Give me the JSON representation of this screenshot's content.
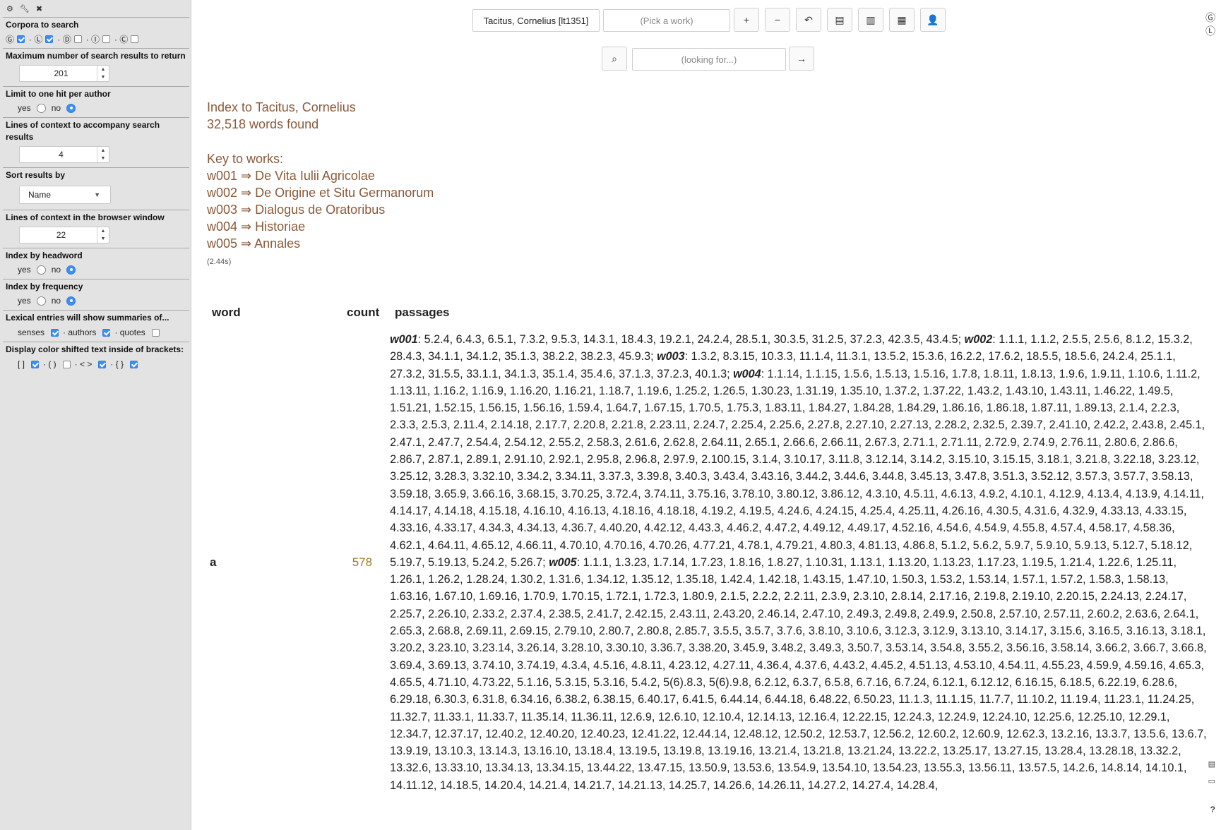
{
  "sidebar": {
    "top_icons": [
      "gear-icon",
      "wrench-icon",
      "close-icon"
    ],
    "top_glyphs": [
      "⚙",
      "🔧",
      "✖"
    ],
    "corpora": {
      "title": "Corpora to search",
      "items": [
        {
          "glyph": "Ⓖ",
          "checked": true
        },
        {
          "glyph": "Ⓛ",
          "checked": true
        },
        {
          "glyph": "Ⓓ",
          "checked": false
        },
        {
          "glyph": "Ⓘ",
          "checked": false
        },
        {
          "glyph": "Ⓒ",
          "checked": false
        }
      ]
    },
    "max_results": {
      "title": "Maximum number of search results to return",
      "value": "201"
    },
    "limit_one_hit": {
      "title": "Limit to one hit per author",
      "yes": "yes",
      "no": "no",
      "selected": "no"
    },
    "context_lines": {
      "title": "Lines of context to accompany search results",
      "value": "4"
    },
    "sort_by": {
      "title": "Sort results by",
      "value": "Name"
    },
    "browser_context": {
      "title": "Lines of context in the browser window",
      "value": "22"
    },
    "index_headword": {
      "title": "Index by headword",
      "yes": "yes",
      "no": "no",
      "selected": "no"
    },
    "index_frequency": {
      "title": "Index by frequency",
      "yes": "yes",
      "no": "no",
      "selected": "no"
    },
    "lexical": {
      "title": "Lexical entries will show summaries of...",
      "senses": "senses",
      "senses_checked": true,
      "authors": "· authors",
      "authors_checked": true,
      "quotes": "· quotes",
      "quotes_checked": false
    },
    "brackets": {
      "title": "Display color shifted text inside of brackets:",
      "items": [
        {
          "label": "[ ]",
          "checked": true
        },
        {
          "label": "· ( )",
          "checked": false
        },
        {
          "label": "· < >",
          "checked": true
        },
        {
          "label": "· { }",
          "checked": true
        }
      ]
    }
  },
  "toolbar": {
    "author": "Tacitus, Cornelius [lt1351]",
    "work_placeholder": "(Pick a work)",
    "search_placeholder": "(looking for...)",
    "buttons": [
      "+",
      "−",
      "↶",
      "▤",
      "▥",
      "▦",
      "👤"
    ],
    "go": "→",
    "search_icon": "⌕"
  },
  "index": {
    "heading": "Index to Tacitus, Cornelius",
    "words_found": "32,518 words found",
    "key_title": "Key to works:",
    "works": [
      "w001 ⇒ De Vita Iulii Agricolae",
      "w002 ⇒ De Origine et Situ Germanorum",
      "w003 ⇒ Dialogus de Oratoribus",
      "w004 ⇒ Historiae",
      "w005 ⇒ Annales"
    ],
    "timing": "(2.44s)"
  },
  "table": {
    "headers": {
      "word": "word",
      "count": "count",
      "passages": "passages"
    },
    "rows": [
      {
        "word": "a",
        "count": "578",
        "passages": [
          {
            "work": "w001",
            "refs": "5.2.4, 6.4.3, 6.5.1, 7.3.2, 9.5.3, 14.3.1, 18.4.3, 19.2.1, 24.2.4, 28.5.1, 30.3.5, 31.2.5, 37.2.3, 42.3.5, 43.4.5"
          },
          {
            "work": "w002",
            "refs": "1.1.1, 1.1.2, 2.5.5, 2.5.6, 8.1.2, 15.3.2, 28.4.3, 34.1.1, 34.1.2, 35.1.3, 38.2.2, 38.2.3, 45.9.3"
          },
          {
            "work": "w003",
            "refs": "1.3.2, 8.3.15, 10.3.3, 11.1.4, 11.3.1, 13.5.2, 15.3.6, 16.2.2, 17.6.2, 18.5.5, 18.5.6, 24.2.4, 25.1.1, 27.3.2, 31.5.5, 33.1.1, 34.1.3, 35.1.4, 35.4.6, 37.1.3, 37.2.3, 40.1.3"
          },
          {
            "work": "w004",
            "refs": "1.1.14, 1.1.15, 1.5.6, 1.5.13, 1.5.16, 1.7.8, 1.8.11, 1.8.13, 1.9.6, 1.9.11, 1.10.6, 1.11.2, 1.13.11, 1.16.2, 1.16.9, 1.16.20, 1.16.21, 1.18.7, 1.19.6, 1.25.2, 1.26.5, 1.30.23, 1.31.19, 1.35.10, 1.37.2, 1.37.22, 1.43.2, 1.43.10, 1.43.11, 1.46.22, 1.49.5, 1.51.21, 1.52.15, 1.56.15, 1.56.16, 1.59.4, 1.64.7, 1.67.15, 1.70.5, 1.75.3, 1.83.11, 1.84.27, 1.84.28, 1.84.29, 1.86.16, 1.86.18, 1.87.11, 1.89.13, 2.1.4, 2.2.3, 2.3.3, 2.5.3, 2.11.4, 2.14.18, 2.17.7, 2.20.8, 2.21.8, 2.23.11, 2.24.7, 2.25.4, 2.25.6, 2.27.8, 2.27.10, 2.27.13, 2.28.2, 2.32.5, 2.39.7, 2.41.10, 2.42.2, 2.43.8, 2.45.1, 2.47.1, 2.47.7, 2.54.4, 2.54.12, 2.55.2, 2.58.3, 2.61.6, 2.62.8, 2.64.11, 2.65.1, 2.66.6, 2.66.11, 2.67.3, 2.71.1, 2.71.11, 2.72.9, 2.74.9, 2.76.11, 2.80.6, 2.86.6, 2.86.7, 2.87.1, 2.89.1, 2.91.10, 2.92.1, 2.95.8, 2.96.8, 2.97.9, 2.100.15, 3.1.4, 3.10.17, 3.11.8, 3.12.14, 3.14.2, 3.15.10, 3.15.15, 3.18.1, 3.21.8, 3.22.18, 3.23.12, 3.25.12, 3.28.3, 3.32.10, 3.34.2, 3.34.11, 3.37.3, 3.39.8, 3.40.3, 3.43.4, 3.43.16, 3.44.2, 3.44.6, 3.44.8, 3.45.13, 3.47.8, 3.51.3, 3.52.12, 3.57.3, 3.57.7, 3.58.13, 3.59.18, 3.65.9, 3.66.16, 3.68.15, 3.70.25, 3.72.4, 3.74.11, 3.75.16, 3.78.10, 3.80.12, 3.86.12, 4.3.10, 4.5.11, 4.6.13, 4.9.2, 4.10.1, 4.12.9, 4.13.4, 4.13.9, 4.14.11, 4.14.17, 4.14.18, 4.15.18, 4.16.10, 4.16.13, 4.18.16, 4.18.18, 4.19.2, 4.19.5, 4.24.6, 4.24.15, 4.25.4, 4.25.11, 4.26.16, 4.30.5, 4.31.6, 4.32.9, 4.33.13, 4.33.15, 4.33.16, 4.33.17, 4.34.3, 4.34.13, 4.36.7, 4.40.20, 4.42.12, 4.43.3, 4.46.2, 4.47.2, 4.49.12, 4.49.17, 4.52.16, 4.54.6, 4.54.9, 4.55.8, 4.57.4, 4.58.17, 4.58.36, 4.62.1, 4.64.11, 4.65.12, 4.66.11, 4.70.10, 4.70.16, 4.70.26, 4.77.21, 4.78.1, 4.79.21, 4.80.3, 4.81.13, 4.86.8, 5.1.2, 5.6.2, 5.9.7, 5.9.10, 5.9.13, 5.12.7, 5.18.12, 5.19.7, 5.19.13, 5.24.2, 5.26.7"
          },
          {
            "work": "w005",
            "refs": "1.1.1, 1.3.23, 1.7.14, 1.7.23, 1.8.16, 1.8.27, 1.10.31, 1.13.1, 1.13.20, 1.13.23, 1.17.23, 1.19.5, 1.21.4, 1.22.6, 1.25.11, 1.26.1, 1.26.2, 1.28.24, 1.30.2, 1.31.6, 1.34.12, 1.35.12, 1.35.18, 1.42.4, 1.42.18, 1.43.15, 1.47.10, 1.50.3, 1.53.2, 1.53.14, 1.57.1, 1.57.2, 1.58.3, 1.58.13, 1.63.16, 1.67.10, 1.69.16, 1.70.9, 1.70.15, 1.72.1, 1.72.3, 1.80.9, 2.1.5, 2.2.2, 2.2.11, 2.3.9, 2.3.10, 2.8.14, 2.17.16, 2.19.8, 2.19.10, 2.20.15, 2.24.13, 2.24.17, 2.25.7, 2.26.10, 2.33.2, 2.37.4, 2.38.5, 2.41.7, 2.42.15, 2.43.11, 2.43.20, 2.46.14, 2.47.10, 2.49.3, 2.49.8, 2.49.9, 2.50.8, 2.57.10, 2.57.11, 2.60.2, 2.63.6, 2.64.1, 2.65.3, 2.68.8, 2.69.11, 2.69.15, 2.79.10, 2.80.7, 2.80.8, 2.85.7, 3.5.5, 3.5.7, 3.7.6, 3.8.10, 3.10.6, 3.12.3, 3.12.9, 3.13.10, 3.14.17, 3.15.6, 3.16.5, 3.16.13, 3.18.1, 3.20.2, 3.23.10, 3.23.14, 3.26.14, 3.28.10, 3.30.10, 3.36.7, 3.38.20, 3.45.9, 3.48.2, 3.49.3, 3.50.7, 3.53.14, 3.54.8, 3.55.2, 3.56.16, 3.58.14, 3.66.2, 3.66.7, 3.66.8, 3.69.4, 3.69.13, 3.74.10, 3.74.19, 4.3.4, 4.5.16, 4.8.11, 4.23.12, 4.27.11, 4.36.4, 4.37.6, 4.43.2, 4.45.2, 4.51.13, 4.53.10, 4.54.11, 4.55.23, 4.59.9, 4.59.16, 4.65.3, 4.65.5, 4.71.10, 4.73.22, 5.1.16, 5.3.15, 5.3.16, 5.4.2, 5(6).8.3, 5(6).9.8, 6.2.12, 6.3.7, 6.5.8, 6.7.16, 6.7.24, 6.12.1, 6.12.12, 6.16.15, 6.18.5, 6.22.19, 6.28.6, 6.29.18, 6.30.3, 6.31.8, 6.34.16, 6.38.2, 6.38.15, 6.40.17, 6.41.5, 6.44.14, 6.44.18, 6.48.22, 6.50.23, 11.1.3, 11.1.15, 11.7.7, 11.10.2, 11.19.4, 11.23.1, 11.24.25, 11.32.7, 11.33.1, 11.33.7, 11.35.14, 11.36.11, 12.6.9, 12.6.10, 12.10.4, 12.14.13, 12.16.4, 12.22.15, 12.24.3, 12.24.9, 12.24.10, 12.25.6, 12.25.10, 12.29.1, 12.34.7, 12.37.17, 12.40.2, 12.40.20, 12.40.23, 12.41.22, 12.44.14, 12.48.12, 12.50.2, 12.53.7, 12.56.2, 12.60.2, 12.60.9, 12.62.3, 13.2.16, 13.3.7, 13.5.6, 13.6.7, 13.9.19, 13.10.3, 13.14.3, 13.16.10, 13.18.4, 13.19.5, 13.19.8, 13.19.16, 13.21.4, 13.21.8, 13.21.24, 13.22.2, 13.25.17, 13.27.15, 13.28.4, 13.28.18, 13.32.2, 13.32.6, 13.33.10, 13.34.13, 13.34.15, 13.44.22, 13.47.15, 13.50.9, 13.53.6, 13.54.9, 13.54.10, 13.54.23, 13.55.3, 13.56.11, 13.57.5, 14.2.6, 14.8.14, 14.10.1, 14.11.12, 14.18.5, 14.20.4, 14.21.4, 14.21.7, 14.21.13, 14.25.7, 14.26.6, 14.26.11, 14.27.2, 14.27.4, 14.28.4,"
          }
        ]
      }
    ]
  },
  "right_edge": {
    "top_glyphs": [
      "Ⓖ",
      "Ⓛ"
    ],
    "bottom_glyphs": [
      "🗄",
      "📂",
      "?"
    ]
  },
  "colors": {
    "accent": "#3b8ff6",
    "heading_brown": "#8a5a3a",
    "count_gold": "#a07a1e",
    "sidebar_bg": "#e3e3e3"
  }
}
